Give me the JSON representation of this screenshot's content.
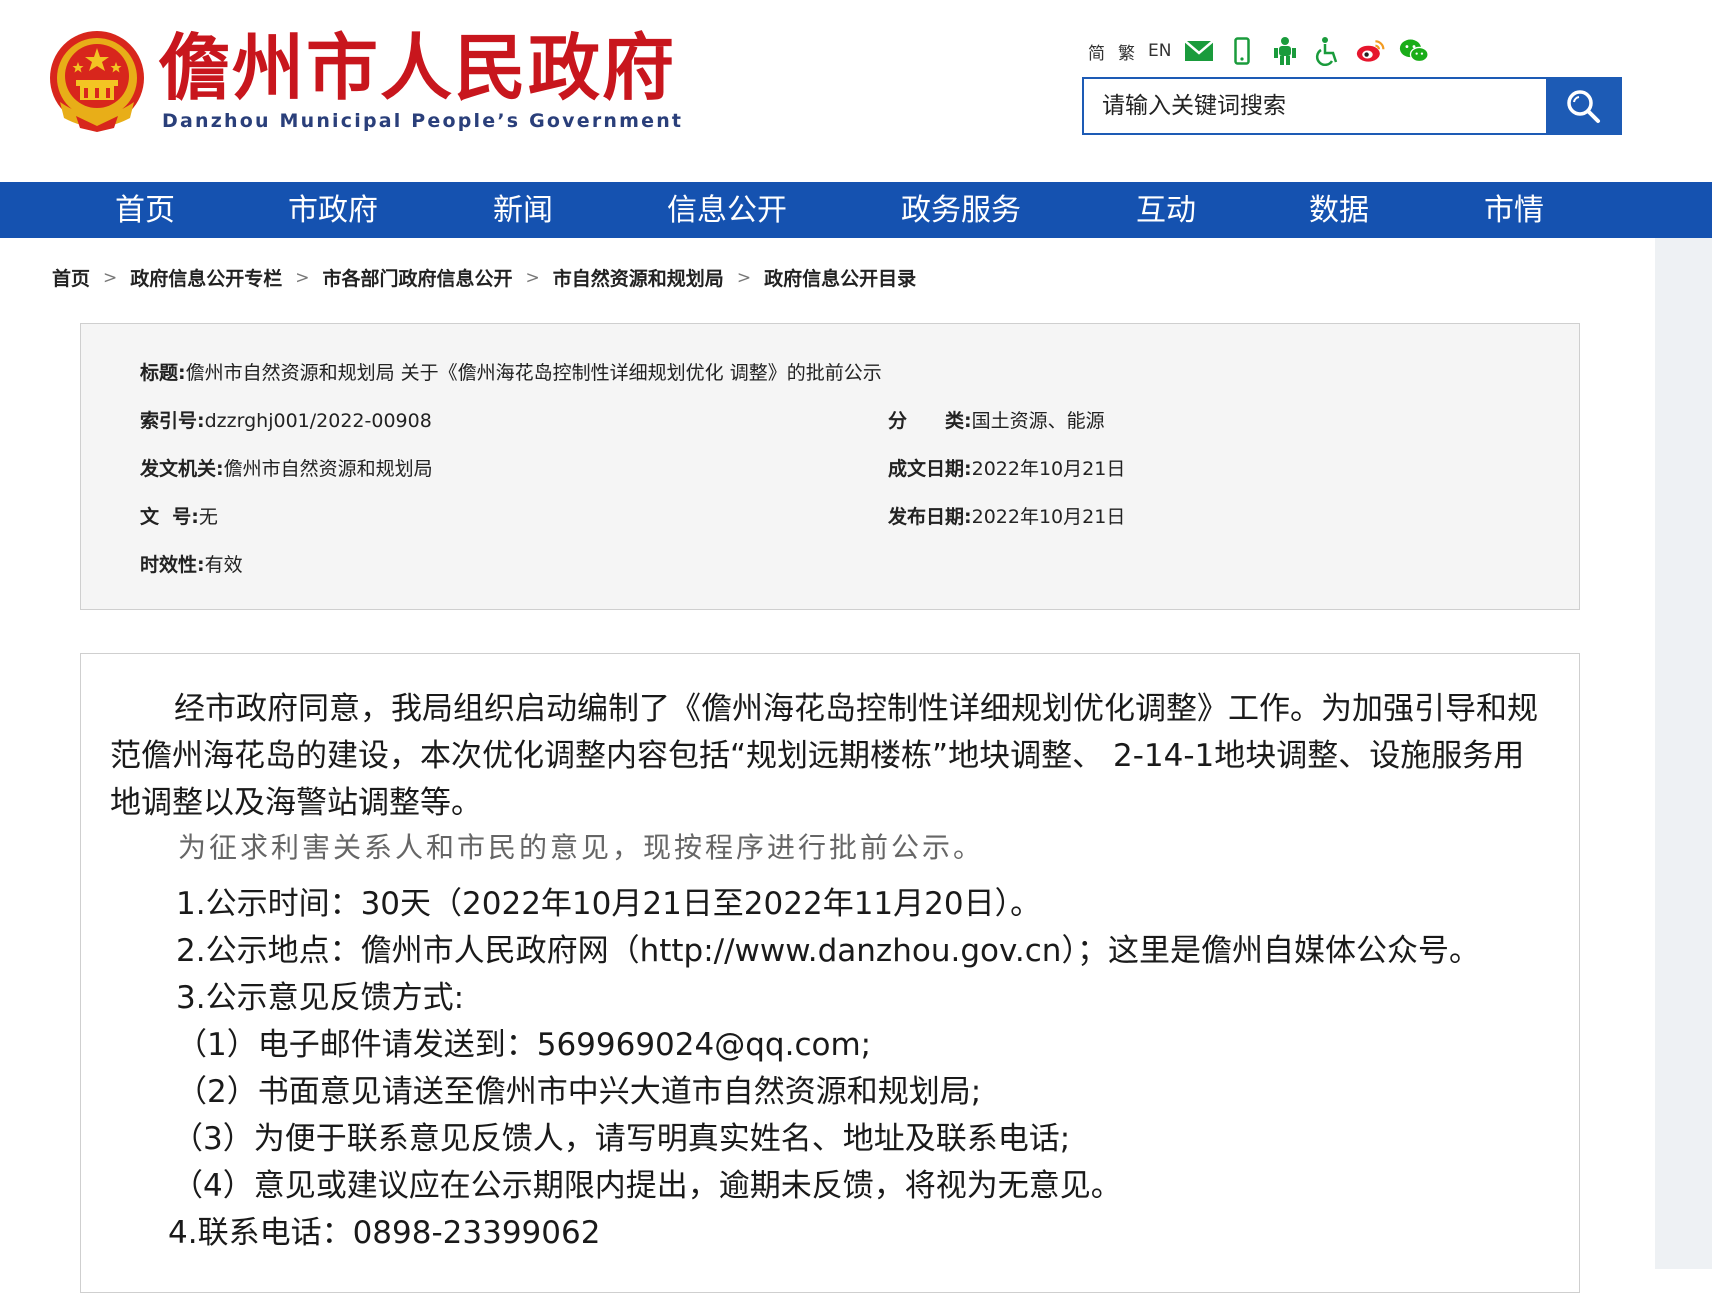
{
  "header": {
    "title": "儋州市人民政府",
    "subtitle": "Danzhou Municipal People’s Government",
    "lang_simplified": "简",
    "lang_traditional": "繁",
    "lang_english": "EN",
    "toolbar_icons": [
      "mail-icon",
      "mobile-icon",
      "elderly-icon",
      "accessibility-icon",
      "weibo-icon",
      "wechat-icon"
    ],
    "search_placeholder": "请输入关键词搜索",
    "brand_red": "#c8161d",
    "brand_blue": "#1552b0"
  },
  "nav": {
    "items": [
      "首页",
      "市政府",
      "新闻",
      "信息公开",
      "政务服务",
      "互动",
      "数据",
      "市情"
    ]
  },
  "breadcrumb": {
    "items": [
      "首页",
      "政府信息公开专栏",
      "市各部门政府信息公开",
      "市自然资源和规划局",
      "政府信息公开目录"
    ],
    "separator": ">"
  },
  "meta": {
    "title_label": "标题:",
    "title_value": "儋州市自然资源和规划局 关于《儋州海花岛控制性详细规划优化 调整》的批前公示",
    "index_label": "索引号:",
    "index_value": "dzzrghj001/2022-00908",
    "category_label": "分　　类:",
    "category_value": "国土资源、能源",
    "issuer_label": "发文机关:",
    "issuer_value": "儋州市自然资源和规划局",
    "written_date_label": "成文日期:",
    "written_date_value": "2022年10月21日",
    "doc_no_label": "文  号:",
    "doc_no_value": "无",
    "publish_date_label": "发布日期:",
    "publish_date_value": "2022年10月21日",
    "validity_label": "时效性:",
    "validity_value": "有效"
  },
  "content": {
    "intro": "经市政府同意，我局组织启动编制了《儋州海花岛控制性详细规划优化调整》工作。为加强引导和规范儋州海花岛的建设，本次优化调整内容包括“规划远期楼栋”地块调整、 2-14-1地块调整、设施服务用地调整以及海警站调整等。",
    "purpose": "为征求利害关系人和市民的意见，现按程序进行批前公示。",
    "item1": "1.公示时间：30天（2022年10月21日至2022年11月20日）。",
    "item2": "2.公示地点：儋州市人民政府网（http://www.danzhou.gov.cn）；这里是儋州自媒体公众号。",
    "item3": "3.公示意见反馈方式:",
    "item3_1": "（1）电子邮件请发送到：569969024@qq.com;",
    "item3_2": "（2）书面意见请送至儋州市中兴大道市自然资源和规划局;",
    "item3_3": "（3）为便于联系意见反馈人，请写明真实姓名、地址及联系电话;",
    "item3_4": "（4）意见或建议应在公示期限内提出，逾期未反馈，将视为无意见。",
    "item4": "4.联系电话：0898-23399062"
  }
}
